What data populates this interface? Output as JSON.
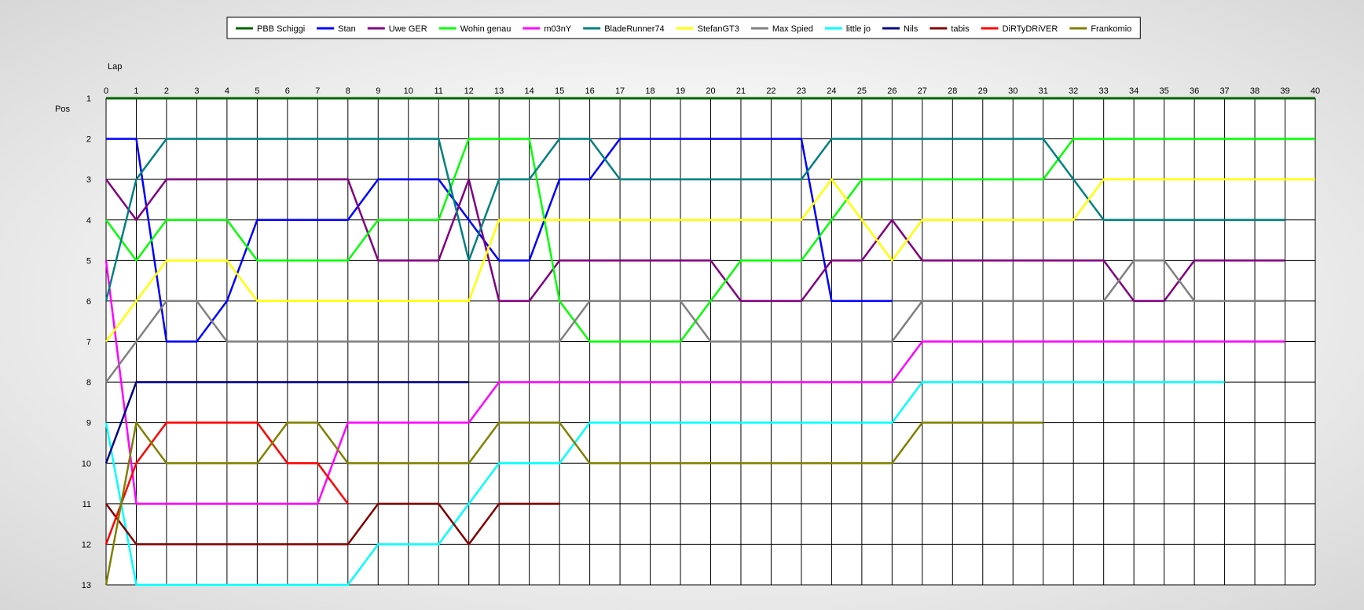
{
  "chart_data": {
    "type": "line",
    "xlabel": "Lap",
    "ylabel": "Pos",
    "xlim": [
      0,
      40
    ],
    "ylim": [
      1,
      13
    ],
    "y_inverted": true,
    "grid": true,
    "legend_position": "top-center",
    "x": [
      0,
      1,
      2,
      3,
      4,
      5,
      6,
      7,
      8,
      9,
      10,
      11,
      12,
      13,
      14,
      15,
      16,
      17,
      18,
      19,
      20,
      21,
      22,
      23,
      24,
      25,
      26,
      27,
      28,
      29,
      30,
      31,
      32,
      33,
      34,
      35,
      36,
      37,
      38,
      39,
      40
    ],
    "x_tick_labels": [
      "0",
      "1",
      "2",
      "3",
      "4",
      "5",
      "6",
      "7",
      "8",
      "9",
      "10",
      "11",
      "12",
      "13",
      "14",
      "15",
      "16",
      "17",
      "18",
      "19",
      "20",
      "21",
      "22",
      "23",
      "24",
      "25",
      "26",
      "27",
      "28",
      "29",
      "30",
      "31",
      "32",
      "33",
      "34",
      "35",
      "36",
      "37",
      "38",
      "39",
      "40"
    ],
    "y_tick_labels": [
      "1",
      "2",
      "3",
      "4",
      "5",
      "6",
      "7",
      "8",
      "9",
      "10",
      "11",
      "12",
      "13"
    ],
    "series": [
      {
        "name": "PBB Schiggi",
        "color": "#006400",
        "values": [
          1,
          1,
          1,
          1,
          1,
          1,
          1,
          1,
          1,
          1,
          1,
          1,
          1,
          1,
          1,
          1,
          1,
          1,
          1,
          1,
          1,
          1,
          1,
          1,
          1,
          1,
          1,
          1,
          1,
          1,
          1,
          1,
          1,
          1,
          1,
          1,
          1,
          1,
          1,
          1,
          1
        ]
      },
      {
        "name": "Stan",
        "color": "#0000ff",
        "values": [
          2,
          2,
          7,
          7,
          6,
          4,
          4,
          4,
          4,
          3,
          3,
          3,
          4,
          5,
          5,
          3,
          3,
          2,
          2,
          2,
          2,
          2,
          2,
          2,
          6,
          6,
          6
        ]
      },
      {
        "name": "Uwe GER",
        "color": "#800080",
        "values": [
          3,
          4,
          3,
          3,
          3,
          3,
          3,
          3,
          3,
          5,
          5,
          5,
          3,
          6,
          6,
          5,
          5,
          5,
          5,
          5,
          5,
          6,
          6,
          6,
          5,
          5,
          4,
          5,
          5,
          5,
          5,
          5,
          5,
          5,
          6,
          6,
          5,
          5,
          5,
          5
        ]
      },
      {
        "name": "Wohin genau",
        "color": "#00ff00",
        "values": [
          4,
          5,
          4,
          4,
          4,
          5,
          5,
          5,
          5,
          4,
          4,
          4,
          2,
          2,
          2,
          6,
          7,
          7,
          7,
          7,
          6,
          5,
          5,
          5,
          4,
          3,
          3,
          3,
          3,
          3,
          3,
          3,
          2,
          2,
          2,
          2,
          2,
          2,
          2,
          2,
          2
        ]
      },
      {
        "name": "m03nY",
        "color": "#ff00ff",
        "values": [
          5,
          11,
          11,
          11,
          11,
          11,
          11,
          11,
          9,
          9,
          9,
          9,
          9,
          8,
          8,
          8,
          8,
          8,
          8,
          8,
          8,
          8,
          8,
          8,
          8,
          8,
          8,
          7,
          7,
          7,
          7,
          7,
          7,
          7,
          7,
          7,
          7,
          7,
          7,
          7
        ]
      },
      {
        "name": "BladeRunner74",
        "color": "#008080",
        "values": [
          6,
          3,
          2,
          2,
          2,
          2,
          2,
          2,
          2,
          2,
          2,
          2,
          5,
          3,
          3,
          2,
          2,
          3,
          3,
          3,
          3,
          3,
          3,
          3,
          2,
          2,
          2,
          2,
          2,
          2,
          2,
          2,
          3,
          4,
          4,
          4,
          4,
          4,
          4,
          4
        ]
      },
      {
        "name": "StefanGT3",
        "color": "#ffff00",
        "values": [
          7,
          6,
          5,
          5,
          5,
          6,
          6,
          6,
          6,
          6,
          6,
          6,
          6,
          4,
          4,
          4,
          4,
          4,
          4,
          4,
          4,
          4,
          4,
          4,
          3,
          4,
          5,
          4,
          4,
          4,
          4,
          4,
          4,
          3,
          3,
          3,
          3,
          3,
          3,
          3,
          3
        ]
      },
      {
        "name": "Max Spied",
        "color": "#808080",
        "values": [
          8,
          7,
          6,
          6,
          7,
          7,
          7,
          7,
          7,
          7,
          7,
          7,
          7,
          7,
          7,
          7,
          6,
          6,
          6,
          6,
          7,
          7,
          7,
          7,
          7,
          7,
          7,
          6,
          6,
          6,
          6,
          6,
          6,
          6,
          5,
          5,
          6,
          6,
          6,
          6
        ]
      },
      {
        "name": "little jo",
        "color": "#00ffff",
        "values": [
          9,
          13,
          13,
          13,
          13,
          13,
          13,
          13,
          13,
          12,
          12,
          12,
          11,
          10,
          10,
          10,
          9,
          9,
          9,
          9,
          9,
          9,
          9,
          9,
          9,
          9,
          9,
          8,
          8,
          8,
          8,
          8,
          8,
          8,
          8,
          8,
          8,
          8
        ]
      },
      {
        "name": "Nils",
        "color": "#000080",
        "values": [
          10,
          8,
          8,
          8,
          8,
          8,
          8,
          8,
          8,
          8,
          8,
          8,
          8
        ]
      },
      {
        "name": "tabis",
        "color": "#800000",
        "values": [
          11,
          12,
          12,
          12,
          12,
          12,
          12,
          12,
          12,
          11,
          11,
          11,
          12,
          11,
          11,
          11
        ]
      },
      {
        "name": "DiRTyDRiVER",
        "color": "#ff0000",
        "values": [
          12,
          10,
          9,
          9,
          9,
          9,
          10,
          10,
          11
        ]
      },
      {
        "name": "Frankomio",
        "color": "#808000",
        "values": [
          13,
          9,
          10,
          10,
          10,
          10,
          9,
          9,
          10,
          10,
          10,
          10,
          10,
          9,
          9,
          9,
          10,
          10,
          10,
          10,
          10,
          10,
          10,
          10,
          10,
          10,
          10,
          9,
          9,
          9,
          9,
          9
        ]
      }
    ]
  }
}
